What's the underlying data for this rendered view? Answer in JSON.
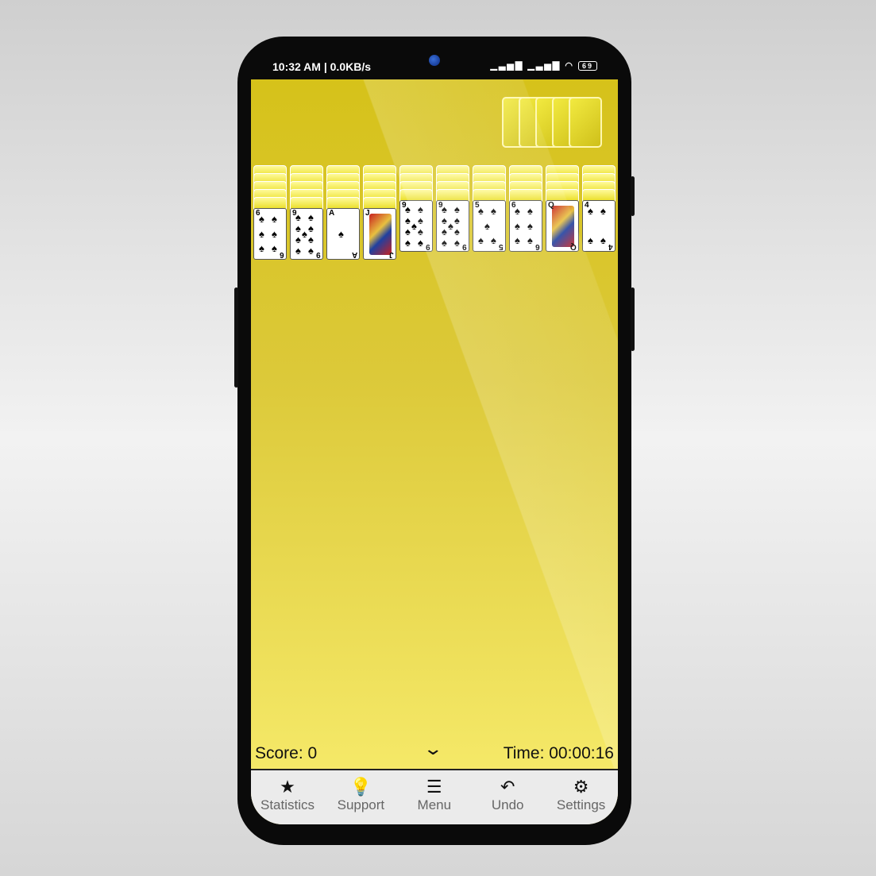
{
  "status_bar": {
    "time": "10:32 AM | 0.0KB/s",
    "signal": "▁▃▅▇ ▁▃▅▇",
    "battery": "69"
  },
  "stock": {
    "count": 5
  },
  "tableau": [
    {
      "face_down": 5,
      "top": "6",
      "suit": "♠"
    },
    {
      "face_down": 5,
      "top": "9",
      "suit": "♠"
    },
    {
      "face_down": 5,
      "top": "A",
      "suit": "♠"
    },
    {
      "face_down": 5,
      "top": "J",
      "suit": "♠"
    },
    {
      "face_down": 4,
      "top": "9",
      "suit": "♠"
    },
    {
      "face_down": 4,
      "top": "9",
      "suit": "♠"
    },
    {
      "face_down": 4,
      "top": "5",
      "suit": "♠"
    },
    {
      "face_down": 4,
      "top": "6",
      "suit": "♠"
    },
    {
      "face_down": 4,
      "top": "Q",
      "suit": "♠"
    },
    {
      "face_down": 4,
      "top": "4",
      "suit": "♠"
    }
  ],
  "score": "Score: 0",
  "time": "Time: 00:00:16",
  "nav": [
    {
      "label": "Statistics",
      "icon": "star-icon",
      "glyph": "★"
    },
    {
      "label": "Support",
      "icon": "lightbulb-icon",
      "glyph": "💡"
    },
    {
      "label": "Menu",
      "icon": "menu-icon",
      "glyph": "☰"
    },
    {
      "label": "Undo",
      "icon": "undo-icon",
      "glyph": "↶"
    },
    {
      "label": "Settings",
      "icon": "gear-icon",
      "glyph": "⚙"
    }
  ],
  "colors": {
    "felt_top": "#d6c21a",
    "felt_bottom": "#f6ea6a",
    "nav_bg": "#ebebeb"
  }
}
